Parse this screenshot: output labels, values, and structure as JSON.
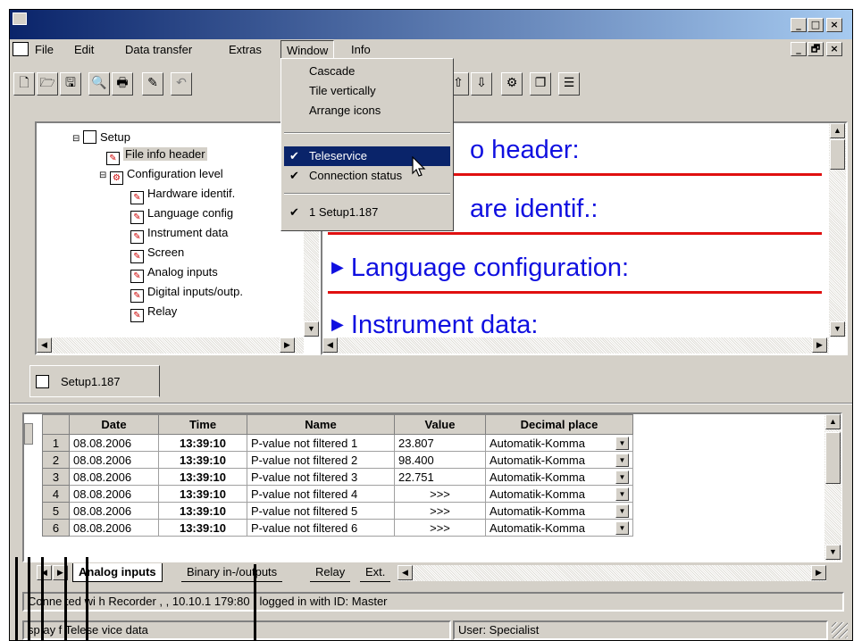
{
  "menubar": {
    "items": [
      "File",
      "Edit",
      "Data transfer",
      "Extras",
      "Window",
      "Info"
    ]
  },
  "window_menu": {
    "items": [
      {
        "label": "Cascade",
        "checked": false
      },
      {
        "label": "Tile vertically",
        "checked": false
      },
      {
        "label": "Arrange icons",
        "checked": false
      },
      {
        "label": "Teleservice",
        "checked": true,
        "selected": true
      },
      {
        "label": "Connection status",
        "checked": true
      },
      {
        "label": "1 Setup1.187",
        "checked": true
      }
    ],
    "check_mark": "✔"
  },
  "tree": {
    "root": "Setup",
    "file_info": "File info header",
    "config": "Configuration level",
    "children": [
      "Hardware identif.",
      "Language config",
      "Instrument data",
      "Screen",
      "Analog inputs",
      "Digital inputs/outp.",
      "Relay"
    ]
  },
  "content": {
    "headings": [
      "o header:",
      "are identif.:",
      "Language configuration:",
      "Instrument data:"
    ],
    "bullet": "▶"
  },
  "doc_tab": {
    "label": "Setup1.187"
  },
  "table": {
    "headers": [
      "Date",
      "Time",
      "Name",
      "Value",
      "Decimal place"
    ],
    "rows": [
      {
        "num": "1",
        "date": "08.08.2006",
        "time": "13:39:10",
        "name": "P-value not filtered 1",
        "value": "23.807",
        "decimal": "Automatik-Komma"
      },
      {
        "num": "2",
        "date": "08.08.2006",
        "time": "13:39:10",
        "name": "P-value not filtered 2",
        "value": "98.400",
        "decimal": "Automatik-Komma"
      },
      {
        "num": "3",
        "date": "08.08.2006",
        "time": "13:39:10",
        "name": "P-value not filtered 3",
        "value": "22.751",
        "decimal": "Automatik-Komma"
      },
      {
        "num": "4",
        "date": "08.08.2006",
        "time": "13:39:10",
        "name": "P-value not filtered 4",
        "value": ">>>",
        "decimal": "Automatik-Komma"
      },
      {
        "num": "5",
        "date": "08.08.2006",
        "time": "13:39:10",
        "name": "P-value not filtered 5",
        "value": ">>>",
        "decimal": "Automatik-Komma"
      },
      {
        "num": "6",
        "date": "08.08.2006",
        "time": "13:39:10",
        "name": "P-value not filtered 6",
        "value": ">>>",
        "decimal": "Automatik-Komma"
      }
    ]
  },
  "sheet_tabs": [
    "Analog inputs",
    "Binary in-/outputs",
    "Relay",
    "Ext."
  ],
  "status": {
    "connection": "Conne ted wi h Recorder ,  , 10.10.1 179:80 , logged in with ID: Master",
    "mode": "sp ay  f Telese vice data",
    "user": "User: Specialist"
  },
  "colors": {
    "heading": "#1010e0",
    "separator": "#e01010",
    "titlebar": "#0a246a"
  },
  "icons": {
    "minimize": "_",
    "maximize": "□",
    "restore": "🗗",
    "close": "×",
    "scroll_up": "▲",
    "scroll_down": "▼",
    "scroll_left": "◀",
    "scroll_right": "▶"
  }
}
